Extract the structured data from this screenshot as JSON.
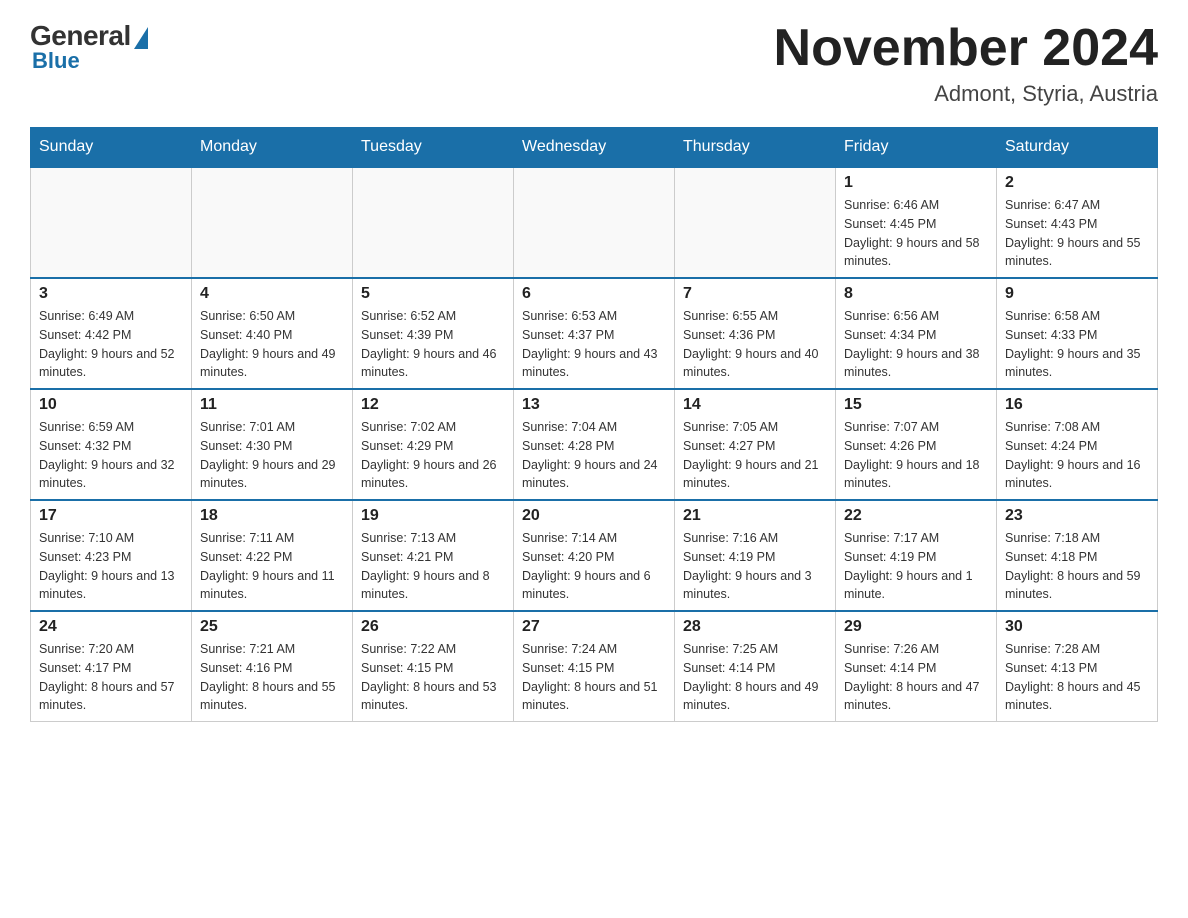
{
  "logo": {
    "general": "General",
    "blue": "Blue",
    "triangle_color": "#1a6fa8"
  },
  "header": {
    "month_year": "November 2024",
    "location": "Admont, Styria, Austria"
  },
  "days_of_week": [
    "Sunday",
    "Monday",
    "Tuesday",
    "Wednesday",
    "Thursday",
    "Friday",
    "Saturday"
  ],
  "weeks": [
    {
      "days": [
        {
          "number": "",
          "info": "",
          "empty": true
        },
        {
          "number": "",
          "info": "",
          "empty": true
        },
        {
          "number": "",
          "info": "",
          "empty": true
        },
        {
          "number": "",
          "info": "",
          "empty": true
        },
        {
          "number": "",
          "info": "",
          "empty": true
        },
        {
          "number": "1",
          "info": "Sunrise: 6:46 AM\nSunset: 4:45 PM\nDaylight: 9 hours and 58 minutes."
        },
        {
          "number": "2",
          "info": "Sunrise: 6:47 AM\nSunset: 4:43 PM\nDaylight: 9 hours and 55 minutes."
        }
      ]
    },
    {
      "days": [
        {
          "number": "3",
          "info": "Sunrise: 6:49 AM\nSunset: 4:42 PM\nDaylight: 9 hours and 52 minutes."
        },
        {
          "number": "4",
          "info": "Sunrise: 6:50 AM\nSunset: 4:40 PM\nDaylight: 9 hours and 49 minutes."
        },
        {
          "number": "5",
          "info": "Sunrise: 6:52 AM\nSunset: 4:39 PM\nDaylight: 9 hours and 46 minutes."
        },
        {
          "number": "6",
          "info": "Sunrise: 6:53 AM\nSunset: 4:37 PM\nDaylight: 9 hours and 43 minutes."
        },
        {
          "number": "7",
          "info": "Sunrise: 6:55 AM\nSunset: 4:36 PM\nDaylight: 9 hours and 40 minutes."
        },
        {
          "number": "8",
          "info": "Sunrise: 6:56 AM\nSunset: 4:34 PM\nDaylight: 9 hours and 38 minutes."
        },
        {
          "number": "9",
          "info": "Sunrise: 6:58 AM\nSunset: 4:33 PM\nDaylight: 9 hours and 35 minutes."
        }
      ]
    },
    {
      "days": [
        {
          "number": "10",
          "info": "Sunrise: 6:59 AM\nSunset: 4:32 PM\nDaylight: 9 hours and 32 minutes."
        },
        {
          "number": "11",
          "info": "Sunrise: 7:01 AM\nSunset: 4:30 PM\nDaylight: 9 hours and 29 minutes."
        },
        {
          "number": "12",
          "info": "Sunrise: 7:02 AM\nSunset: 4:29 PM\nDaylight: 9 hours and 26 minutes."
        },
        {
          "number": "13",
          "info": "Sunrise: 7:04 AM\nSunset: 4:28 PM\nDaylight: 9 hours and 24 minutes."
        },
        {
          "number": "14",
          "info": "Sunrise: 7:05 AM\nSunset: 4:27 PM\nDaylight: 9 hours and 21 minutes."
        },
        {
          "number": "15",
          "info": "Sunrise: 7:07 AM\nSunset: 4:26 PM\nDaylight: 9 hours and 18 minutes."
        },
        {
          "number": "16",
          "info": "Sunrise: 7:08 AM\nSunset: 4:24 PM\nDaylight: 9 hours and 16 minutes."
        }
      ]
    },
    {
      "days": [
        {
          "number": "17",
          "info": "Sunrise: 7:10 AM\nSunset: 4:23 PM\nDaylight: 9 hours and 13 minutes."
        },
        {
          "number": "18",
          "info": "Sunrise: 7:11 AM\nSunset: 4:22 PM\nDaylight: 9 hours and 11 minutes."
        },
        {
          "number": "19",
          "info": "Sunrise: 7:13 AM\nSunset: 4:21 PM\nDaylight: 9 hours and 8 minutes."
        },
        {
          "number": "20",
          "info": "Sunrise: 7:14 AM\nSunset: 4:20 PM\nDaylight: 9 hours and 6 minutes."
        },
        {
          "number": "21",
          "info": "Sunrise: 7:16 AM\nSunset: 4:19 PM\nDaylight: 9 hours and 3 minutes."
        },
        {
          "number": "22",
          "info": "Sunrise: 7:17 AM\nSunset: 4:19 PM\nDaylight: 9 hours and 1 minute."
        },
        {
          "number": "23",
          "info": "Sunrise: 7:18 AM\nSunset: 4:18 PM\nDaylight: 8 hours and 59 minutes."
        }
      ]
    },
    {
      "days": [
        {
          "number": "24",
          "info": "Sunrise: 7:20 AM\nSunset: 4:17 PM\nDaylight: 8 hours and 57 minutes."
        },
        {
          "number": "25",
          "info": "Sunrise: 7:21 AM\nSunset: 4:16 PM\nDaylight: 8 hours and 55 minutes."
        },
        {
          "number": "26",
          "info": "Sunrise: 7:22 AM\nSunset: 4:15 PM\nDaylight: 8 hours and 53 minutes."
        },
        {
          "number": "27",
          "info": "Sunrise: 7:24 AM\nSunset: 4:15 PM\nDaylight: 8 hours and 51 minutes."
        },
        {
          "number": "28",
          "info": "Sunrise: 7:25 AM\nSunset: 4:14 PM\nDaylight: 8 hours and 49 minutes."
        },
        {
          "number": "29",
          "info": "Sunrise: 7:26 AM\nSunset: 4:14 PM\nDaylight: 8 hours and 47 minutes."
        },
        {
          "number": "30",
          "info": "Sunrise: 7:28 AM\nSunset: 4:13 PM\nDaylight: 8 hours and 45 minutes."
        }
      ]
    }
  ]
}
